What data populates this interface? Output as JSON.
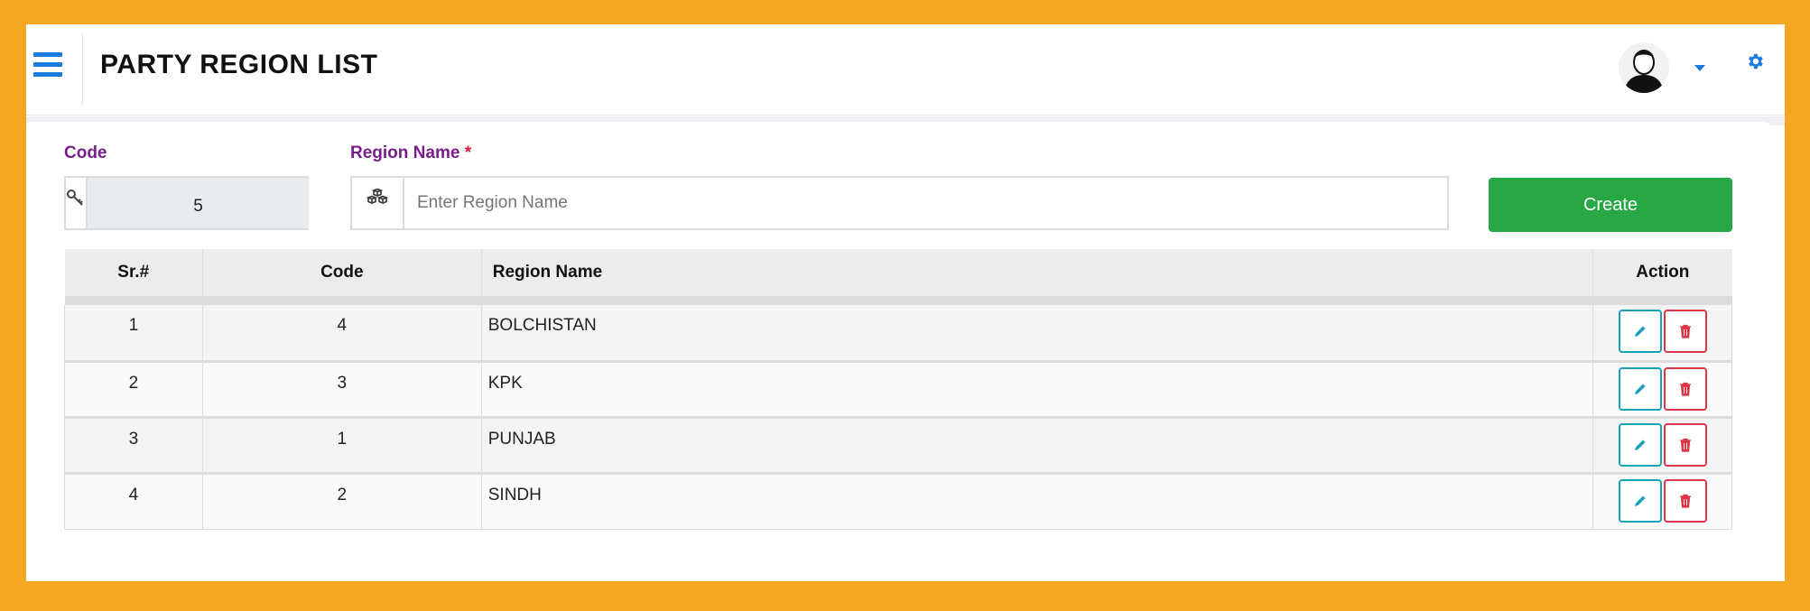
{
  "header": {
    "title": "PARTY REGION LIST"
  },
  "form": {
    "code_label": "Code",
    "code_value": "5",
    "region_label": "Region Name",
    "required_mark": "*",
    "region_placeholder": "Enter Region Name",
    "region_value": "",
    "create_label": "Create"
  },
  "table": {
    "columns": [
      "Sr.#",
      "Code",
      "Region Name",
      "Action"
    ],
    "rows": [
      {
        "sr": "1",
        "code": "4",
        "name": "BOLCHISTAN"
      },
      {
        "sr": "2",
        "code": "3",
        "name": "KPK"
      },
      {
        "sr": "3",
        "code": "1",
        "name": "PUNJAB"
      },
      {
        "sr": "4",
        "code": "2",
        "name": "SINDH"
      }
    ]
  },
  "icons": {
    "menu": "hamburger-icon",
    "avatar": "user-avatar",
    "dropdown": "caret-down-icon",
    "settings": "gear-icon",
    "code_addon": "key-icon",
    "region_addon": "cubes-icon",
    "edit": "pencil-icon",
    "delete": "trash-icon"
  },
  "colors": {
    "frame": "#f5a623",
    "accent": "#1a7ae0",
    "label": "#7a1d8c",
    "required": "#d41f3a",
    "create": "#28a745",
    "edit": "#17a2b8",
    "delete": "#dc3545"
  }
}
